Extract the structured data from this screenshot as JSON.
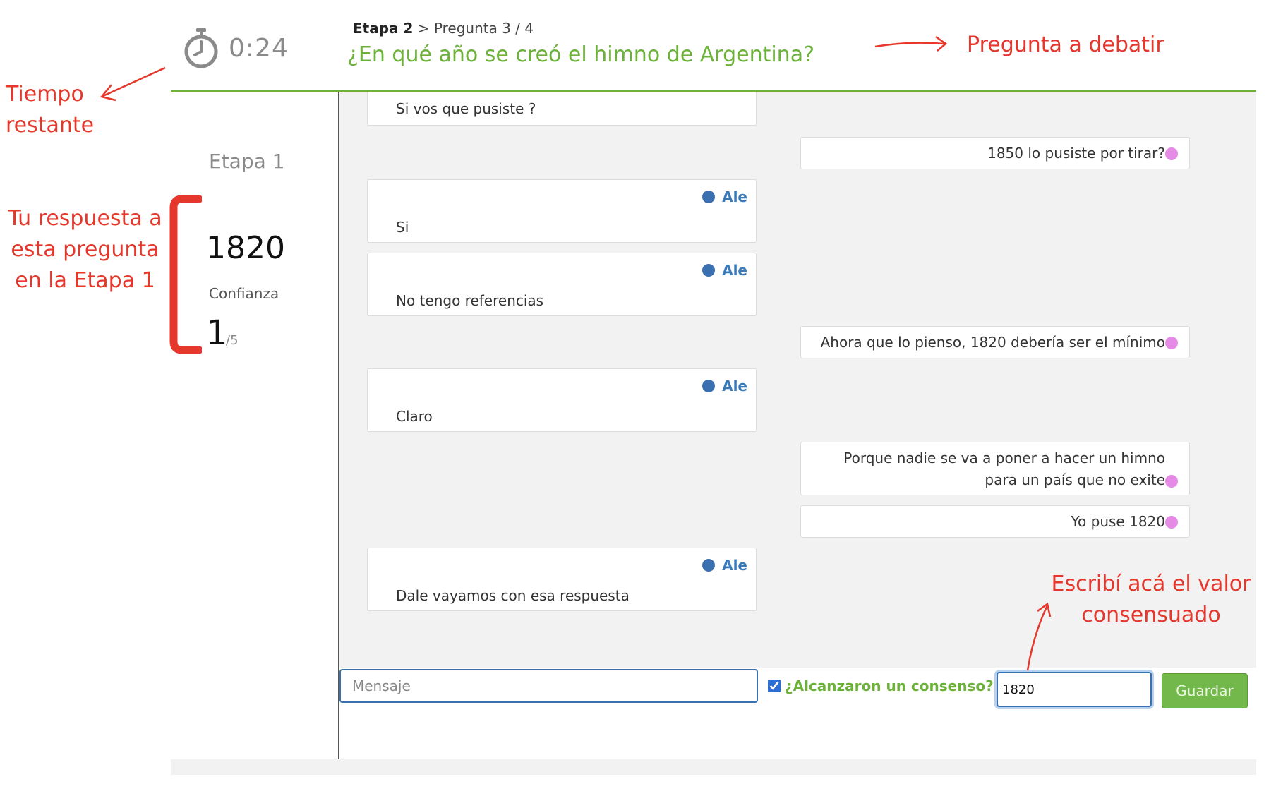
{
  "header": {
    "timer": "0:24",
    "breadcrumb": {
      "stage": "Etapa 2",
      "separator": " > ",
      "question": "Pregunta 3 / 4"
    },
    "question": "¿En qué año se creó el himno de Argentina?"
  },
  "sidebar": {
    "stage_title": "Etapa 1",
    "answer": "1820",
    "confidence_label": "Confianza",
    "confidence_value": "1",
    "confidence_max": "/5"
  },
  "chat": {
    "messages": [
      {
        "side": "left",
        "author": "",
        "text": "Si vos que pusiste ?"
      },
      {
        "side": "right",
        "author": "",
        "text": "1850 lo pusiste por tirar?"
      },
      {
        "side": "left",
        "author": "Ale",
        "text": "Si"
      },
      {
        "side": "left",
        "author": "Ale",
        "text": "No tengo referencias"
      },
      {
        "side": "right",
        "author": "",
        "text": "Ahora que lo pienso, 1820 debería ser el mínimo"
      },
      {
        "side": "left",
        "author": "Ale",
        "text": "Claro"
      },
      {
        "side": "right",
        "author": "",
        "text": "Porque nadie se va a poner a hacer un himno para un país que no exite"
      },
      {
        "side": "right",
        "author": "",
        "text": "Yo puse 1820"
      },
      {
        "side": "left",
        "author": "Ale",
        "text": "Dale vayamos con esa respuesta"
      }
    ]
  },
  "footer": {
    "message_placeholder": "Mensaje",
    "consensus_label": "¿Alcanzaron un consenso?",
    "consensus_checked": true,
    "consensus_value": "1820",
    "save_label": "Guardar"
  },
  "annotations": {
    "time_left": "Tiempo restante",
    "question_to_debate": "Pregunta a debatir",
    "your_answer": "Tu respuesta a esta pregunta en la Etapa 1",
    "write_value": "Escribí acá el valor consensuado"
  },
  "colors": {
    "accent_green": "#6cb23a",
    "annotation_red": "#e5372b",
    "author_blue": "#3a6fb0",
    "peer_pink": "#e58be6"
  }
}
